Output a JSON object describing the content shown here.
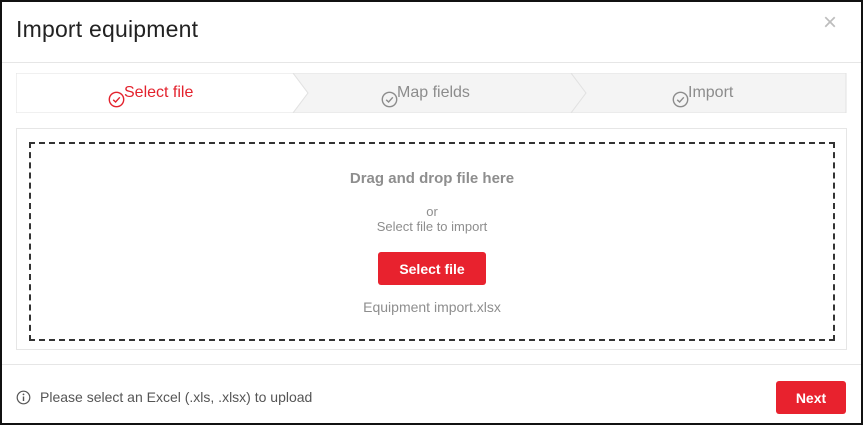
{
  "dialog": {
    "title": "Import equipment",
    "close_icon": "close-icon",
    "close_glyph": "×"
  },
  "steps": [
    {
      "label": "Select file",
      "icon": "check-circle-icon",
      "state": "active"
    },
    {
      "label": "Map fields",
      "icon": "check-circle-icon",
      "state": "inactive"
    },
    {
      "label": "Import",
      "icon": "check-circle-icon",
      "state": "inactive"
    }
  ],
  "dropzone": {
    "title": "Drag and drop file here",
    "or": "or",
    "subtitle": "Select file to import",
    "button_label": "Select file",
    "file_name": "Equipment import.xlsx"
  },
  "footer": {
    "info_icon": "info-icon",
    "hint": "Please select an Excel (.xls, .xlsx) to upload",
    "next_label": "Next"
  },
  "colors": {
    "accent": "#e8222e",
    "active_step": "#e3222d",
    "inactive_step": "#8c8c8c",
    "step_active_bg": "#ffffff",
    "step_inactive_bg": "#f4f4f4"
  }
}
